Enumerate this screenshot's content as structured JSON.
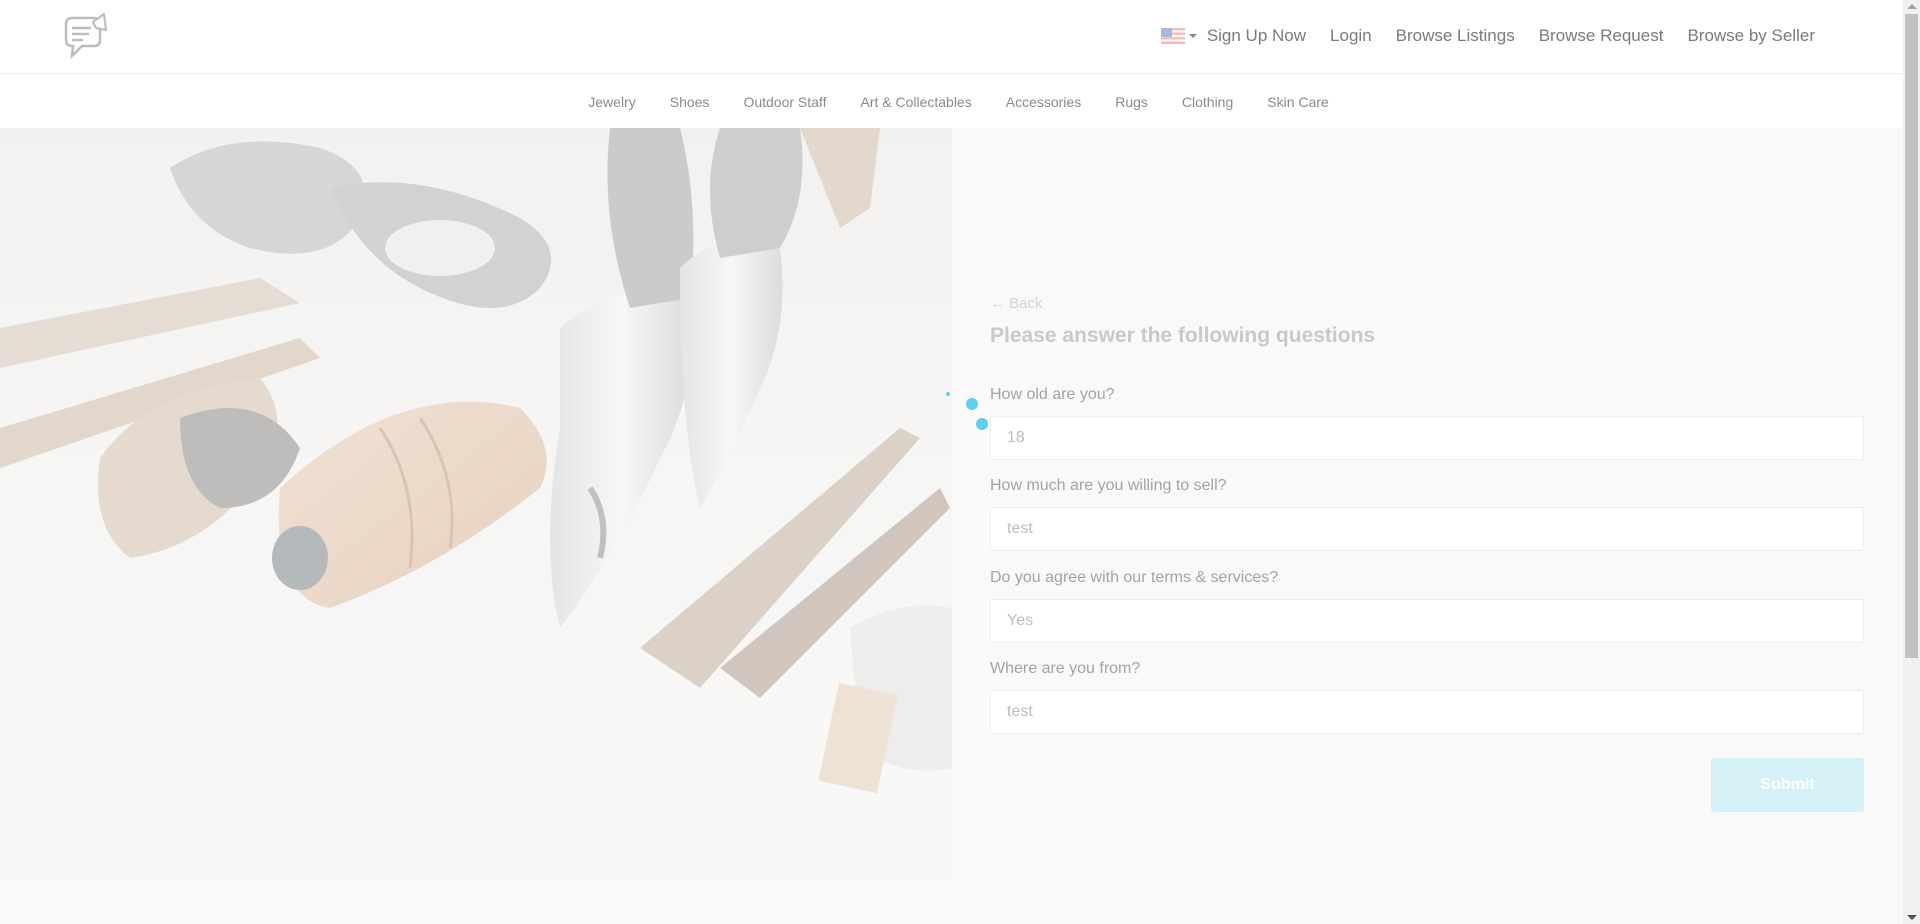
{
  "header": {
    "nav_links": [
      "Sign Up Now",
      "Login",
      "Browse Listings",
      "Browse Request",
      "Browse by Seller"
    ]
  },
  "categories": [
    "Jewelry",
    "Shoes",
    "Outdoor Staff",
    "Art & Collectables",
    "Accessories",
    "Rugs",
    "Clothing",
    "Skin Care"
  ],
  "form": {
    "back_label": "Back",
    "title": "Please answer the following questions",
    "questions": [
      {
        "label": "How old are you?",
        "value": "18"
      },
      {
        "label": "How much are you willing to sell?",
        "value": "test"
      },
      {
        "label": "Do you agree with our terms & services?",
        "value": "Yes"
      },
      {
        "label": "Where are you from?",
        "value": "test"
      }
    ],
    "submit_label": "Submit"
  },
  "colors": {
    "accent": "#5ed0ee",
    "submit_bg": "#d3f1f7"
  },
  "icons": {
    "logo": "megaphone-chat-logo",
    "language": "us-flag-icon",
    "back": "arrow-left-icon",
    "loading": "spinner-icon"
  }
}
